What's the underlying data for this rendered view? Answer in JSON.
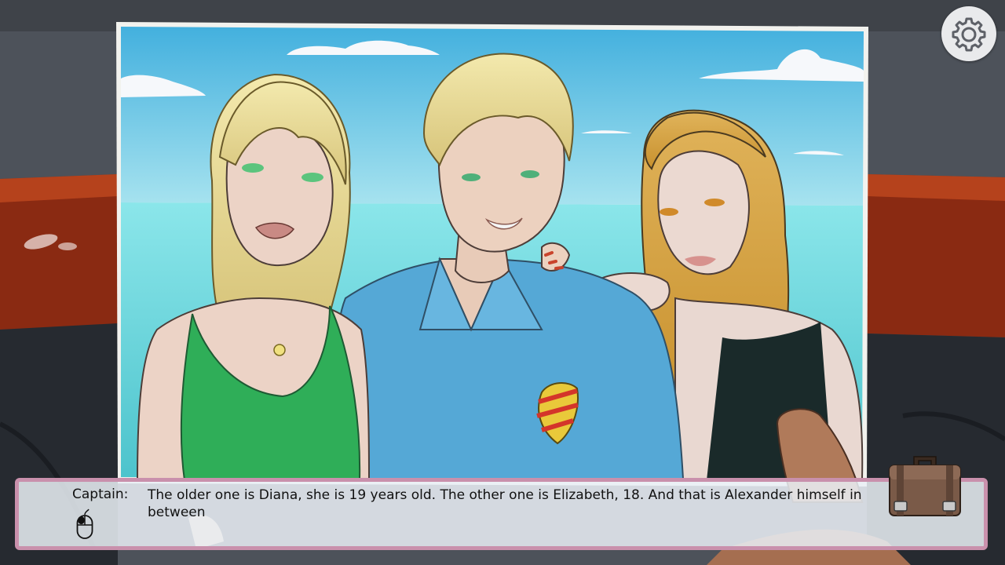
{
  "dialog": {
    "speaker": "Captain:",
    "text": "The older one is Diana, she is 19 years old. The other one is Elizabeth, 18. And that is Alexander himself in between"
  },
  "controls": {
    "settings_icon": "gear-icon",
    "inventory_icon": "briefcase-icon",
    "advance_icon": "mouse-click-icon"
  },
  "colors": {
    "dialog_border": "#c990ac",
    "dialog_bg": "#eaf0f6",
    "sky": "#62c3e4",
    "sea": "#7fe3e8"
  }
}
